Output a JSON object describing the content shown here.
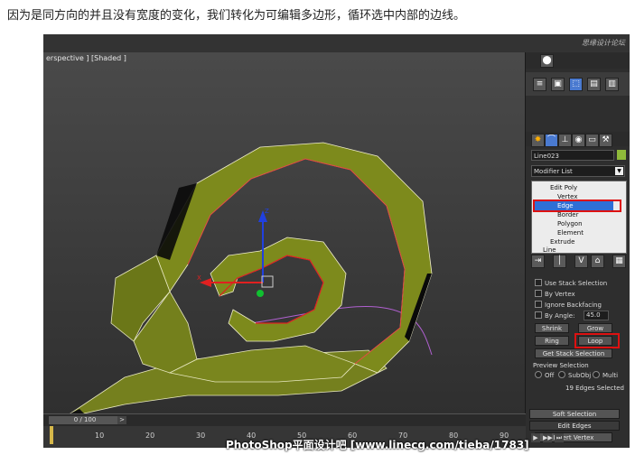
{
  "caption": "因为是同方向的并且没有宽度的变化，我们转化为可编辑多边形，循环选中内部的边线。",
  "viewport": {
    "label": "erspective ] [Shaded ]"
  },
  "panel": {
    "object_name": "Line023",
    "modifier_list": "Modifier List",
    "stack_items": [
      "Edit Poly",
      "Vertex",
      "Edge",
      "Border",
      "Polygon",
      "Element",
      "Extrude",
      "Line"
    ],
    "selected_item": "Edge",
    "use_stack_selection": "Use Stack Selection",
    "by_vertex": "By Vertex",
    "ignore_backfacing": "Ignore Backfacing",
    "by_angle": "By Angle:",
    "angle_value": "45.0",
    "shrink": "Shrink",
    "grow": "Grow",
    "ring": "Ring",
    "loop": "Loop",
    "get_stack_selection": "Get Stack Selection",
    "preview_selection": "Preview Selection",
    "off": "Off",
    "subobj": "SubObj",
    "multi": "Multi",
    "edges_selected": "19 Edges Selected",
    "soft_selection": "Soft Selection",
    "edit_edges": "Edit Edges",
    "insert_vertex": "Insert Vertex"
  },
  "timeline": {
    "slider": "0 / 100",
    "next": ">",
    "ticks": [
      "10",
      "20",
      "30",
      "40",
      "50",
      "60",
      "70",
      "80",
      "90"
    ]
  },
  "watermark_top": "思缘设计论坛",
  "watermark_bottom": "PhotoShop平面设计吧 [www.linecg.com/tieba/1783]",
  "colors": {
    "geometry": "#7d8a1c",
    "selected": "#2f6fd6",
    "highlight_box": "#dd1111"
  }
}
